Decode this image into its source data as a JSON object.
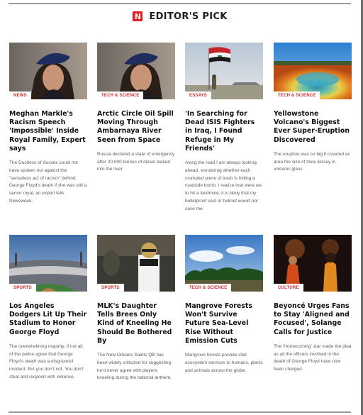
{
  "header": {
    "logo_letter": "N",
    "title": "EDITOR'S PICK"
  },
  "articles": [
    {
      "tag": "NEWS",
      "title": "Meghan Markle's Racism Speech 'Impossible' Inside Royal Family, Expert says",
      "desc": "The Duchess of Sussex could not have spoken out against the \"senseless act of racism\" behind George Floyd's death if she was still a senior royal, an expert tells Newsweek.",
      "image_icon": "portrait-photo"
    },
    {
      "tag": "TECH & SCIENCE",
      "title": "Arctic Circle Oil Spill Moving Through Ambarnaya River Seen from Space",
      "desc": "Russia declared a state of emergency after 20,000 tonnes of diesel leaked into the river",
      "image_icon": "portrait-photo"
    },
    {
      "tag": "ESSAYS",
      "title": "'In Searching for Dead ISIS Fighters in Iraq, I Found Refuge in My Friends'",
      "desc": "Along the road I am always looking ahead, wondering whether each crumpled piece of trash is hiding a roadside bomb. I realize that were we to hit a landmine, it is likely that my bulletproof vest or helmet would not save me.",
      "image_icon": "flag-soldier-photo"
    },
    {
      "tag": "TECH & SCIENCE",
      "title": "Yellowstone Volcano's Biggest Ever Super-Eruption Discovered",
      "desc": "The eruption was so big it covered an area the size of New Jersey in volcanic glass.",
      "image_icon": "hot-spring-photo"
    },
    {
      "tag": "SPORTS",
      "title": "Los Angeles Dodgers Lit Up Their Stadium to Honor George Floyd",
      "desc": "The overwhelming majority, if not all, of the police agree that George Floyd's death was a disgraceful incident. But you don't riot. You don't steal and respond with violence.",
      "image_icon": "stadium-photo"
    },
    {
      "tag": "SPORTS",
      "title": "MLK's Daughter Tells Brees Only Kind of Kneeling He Should Be Bothered By",
      "desc": "The New Orleans Saints QB has been widely criticized for suggesting he'd never agree with players kneeling during the national anthem.",
      "image_icon": "football-player-photo"
    },
    {
      "tag": "TECH & SCIENCE",
      "title": "Mangrove Forests Won't Survive Future Sea-Level Rise Without Emission Cuts",
      "desc": "Mangrove forests provide vital ecosystem services to humans, plants and animals across the globe.",
      "image_icon": "mangrove-photo"
    },
    {
      "tag": "CULTURE",
      "title": "Beyoncé Urges Fans to Stay 'Aligned and Focused', Solange Calls for Justice",
      "desc": "The 'Homecoming' star made the plea as all the officers involved in the death of George Floyd have now been charged.",
      "image_icon": "concert-photo"
    }
  ]
}
